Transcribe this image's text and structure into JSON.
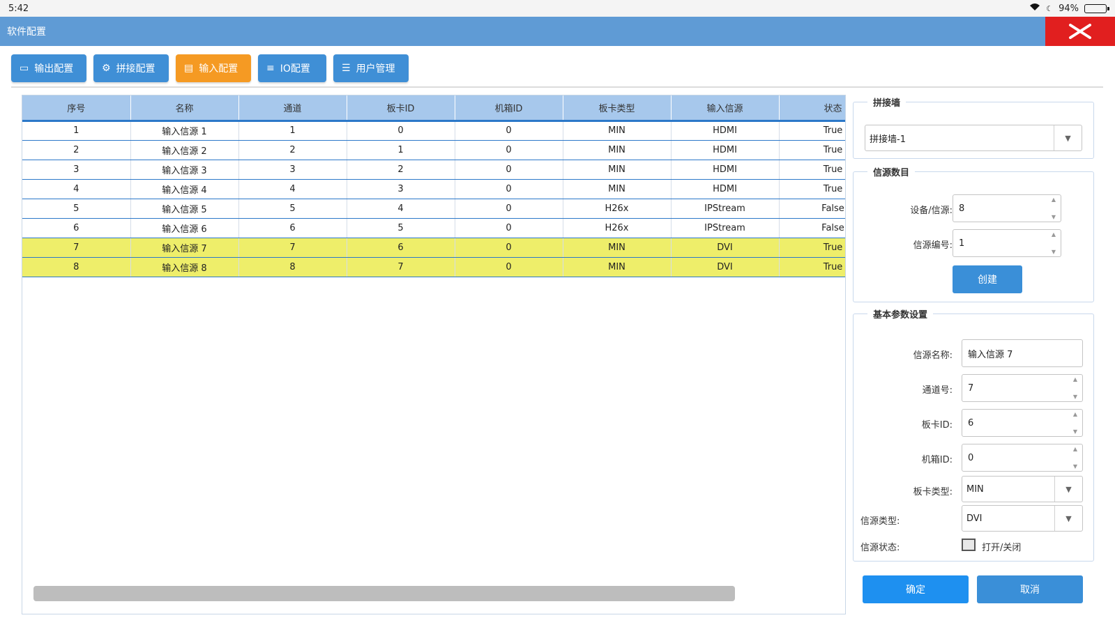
{
  "status": {
    "time": "5:42",
    "battery": "94%",
    "battery_level": 0.94
  },
  "window": {
    "title": "软件配置"
  },
  "toolbar": {
    "tabs": [
      {
        "label": "输出配置",
        "icon": "monitor-icon",
        "active": false
      },
      {
        "label": "拼接配置",
        "icon": "gear-icon",
        "active": false
      },
      {
        "label": "输入配置",
        "icon": "input-icon",
        "active": true
      },
      {
        "label": "IO配置",
        "icon": "io-icon",
        "active": false
      },
      {
        "label": "用户管理",
        "icon": "user-icon",
        "active": false
      }
    ]
  },
  "table": {
    "columns": [
      "序号",
      "名称",
      "通道",
      "板卡ID",
      "机箱ID",
      "板卡类型",
      "输入信源",
      "状态"
    ],
    "rows": [
      [
        "1",
        "输入信源 1",
        "1",
        "0",
        "0",
        "MIN",
        "HDMI",
        "True"
      ],
      [
        "2",
        "输入信源 2",
        "2",
        "1",
        "0",
        "MIN",
        "HDMI",
        "True"
      ],
      [
        "3",
        "输入信源 3",
        "3",
        "2",
        "0",
        "MIN",
        "HDMI",
        "True"
      ],
      [
        "4",
        "输入信源 4",
        "4",
        "3",
        "0",
        "MIN",
        "HDMI",
        "True"
      ],
      [
        "5",
        "输入信源 5",
        "5",
        "4",
        "0",
        "H26x",
        "IPStream",
        "False"
      ],
      [
        "6",
        "输入信源 6",
        "6",
        "5",
        "0",
        "H26x",
        "IPStream",
        "False"
      ],
      [
        "7",
        "输入信源 7",
        "7",
        "6",
        "0",
        "MIN",
        "DVI",
        "True"
      ],
      [
        "8",
        "输入信源 8",
        "8",
        "7",
        "0",
        "MIN",
        "DVI",
        "True"
      ]
    ],
    "highlighted_rows": [
      6,
      7
    ]
  },
  "wall_group": {
    "legend": "拼接墙",
    "selected": "拼接墙-1"
  },
  "source_group": {
    "legend": "信源数目",
    "device_label": "设备/信源:",
    "device_value": "8",
    "number_label": "信源编号:",
    "number_value": "1",
    "create_label": "创建"
  },
  "basic_group": {
    "legend": "基本参数设置",
    "name_label": "信源名称:",
    "name_value": "输入信源 7",
    "channel_label": "通道号:",
    "channel_value": "7",
    "card_id_label": "板卡ID:",
    "card_id_value": "6",
    "chassis_id_label": "机箱ID:",
    "chassis_id_value": "0",
    "card_type_label": "板卡类型:",
    "card_type_value": "MIN",
    "source_type_label": "信源类型:",
    "source_type_value": "DVI",
    "state_label": "信源状态:",
    "state_text": "打开/关闭"
  },
  "actions": {
    "confirm": "确定",
    "cancel": "取消"
  },
  "colors": {
    "titlebar": "#5f9bd5",
    "close": "#e11f1f",
    "tab": "#3f8fd6",
    "tab_active": "#f59a23",
    "highlight": "#eeee6a",
    "confirm": "#1e90f0",
    "cancel": "#3a8fd8"
  }
}
